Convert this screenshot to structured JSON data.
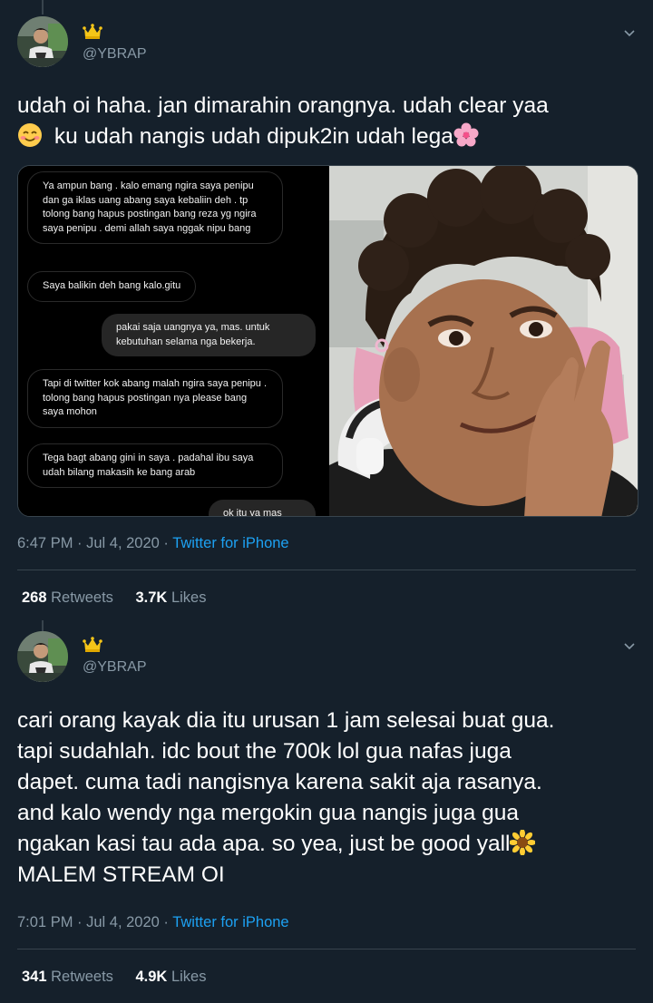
{
  "tweets": [
    {
      "handle": "@YBRAP",
      "text_line1": "udah oi haha. jan dimarahin orangnya. udah clear yaa",
      "text_line2": "ku udah nangis udah dipuk2in udah lega",
      "emoji_before": "smiling-face-with-smiling-eyes",
      "emoji_after": "cherry-blossom",
      "media": {
        "chat": {
          "messages": [
            {
              "from": "them",
              "text": "Ya ampun bang . kalo emang ngira saya penipu dan ga iklas uang abang saya kebaliin deh . tp tolong bang hapus postingan bang reza yg ngira saya penipu . demi allah saya nggak nipu bang"
            },
            {
              "from": "them",
              "text": "Saya balikin deh bang kalo.gitu"
            },
            {
              "from": "me",
              "text": "pakai saja uangnya ya, mas. untuk kebutuhan selama nga bekerja."
            },
            {
              "from": "them",
              "text": "Tapi di twitter kok abang malah ngira saya penipu . tolong bang hapus postingan nya please bang saya mohon"
            },
            {
              "from": "them",
              "text": "Tega bagt abang gini in saya . padahal ibu saya udah bilang makasih ke bang arab"
            },
            {
              "from": "me",
              "text": "ok itu ya mas"
            }
          ]
        },
        "photo_desc": "selfie-photo"
      },
      "time": "6:47 PM · Jul 4, 2020 · ",
      "source": "Twitter for iPhone",
      "retweets_count": "268",
      "retweets_label": "Retweets",
      "likes_count": "3.7K",
      "likes_label": "Likes"
    },
    {
      "handle": "@YBRAP",
      "lines": [
        "cari orang kayak dia itu urusan 1 jam selesai buat gua.",
        "tapi sudahlah. idc bout the 700k lol gua nafas juga",
        "dapet. cuma tadi nangisnya karena sakit aja rasanya.",
        "and kalo wendy nga mergokin gua nangis juga gua",
        "ngakan kasi tau ada apa. so yea, just be good yall",
        "MALEM STREAM OI"
      ],
      "emoji_after_line5": "sunflower",
      "time": "7:01 PM · Jul 4, 2020 · ",
      "source": "Twitter for iPhone",
      "retweets_count": "341",
      "retweets_label": "Retweets",
      "likes_count": "4.9K",
      "likes_label": "Likes"
    }
  ],
  "colors": {
    "background": "#15202b",
    "secondary_text": "#8899a6",
    "link": "#1da1f2",
    "border": "#38444d"
  }
}
